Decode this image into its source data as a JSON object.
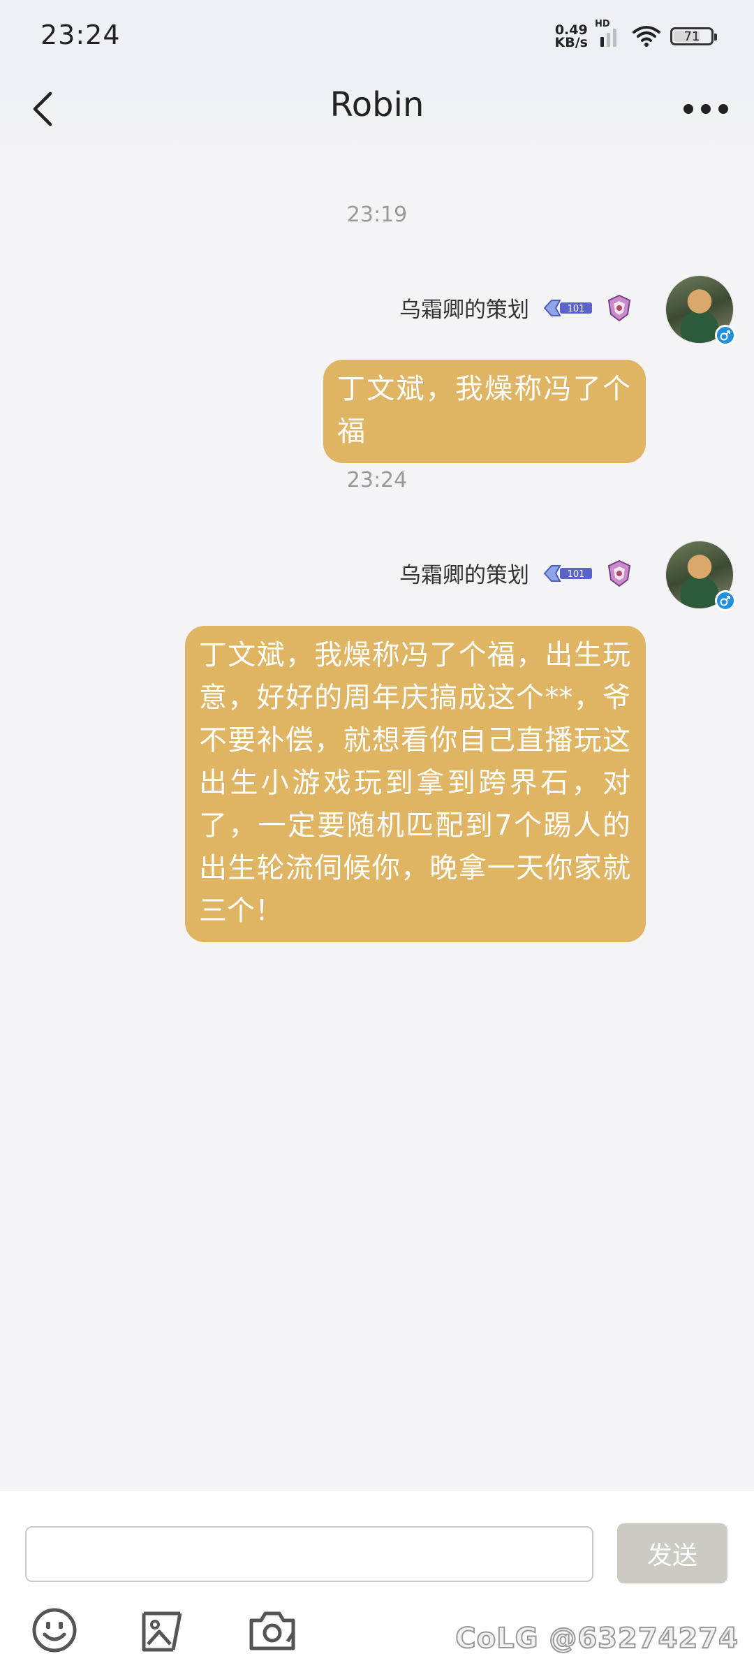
{
  "status_bar": {
    "time": "23:24",
    "net_speed_value": "0.49",
    "net_speed_unit": "KB/s",
    "hd_label": "HD",
    "battery": "71",
    "battery_level": 0.71
  },
  "header": {
    "title": "Robin"
  },
  "messages": [
    {
      "timestamp": "23:19",
      "sender": "乌霜卿的策划",
      "text": "丁文斌，我燥称冯了个福"
    },
    {
      "timestamp": "23:24",
      "sender": "乌霜卿的策划",
      "text": "丁文斌，我燥称冯了个福，出生玩意，好好的周年庆搞成这个**，爷不要补偿，就想看你自己直播玩这出生小游戏玩到拿到跨界石，对了，一定要随机匹配到7个踢人的出生轮流伺候你，晚拿一天你家就三个！"
    }
  ],
  "badges": {
    "rank_text": "101"
  },
  "input": {
    "value": "",
    "placeholder": ""
  },
  "send_label": "发送",
  "toolbar": [
    "emoji-icon",
    "image-icon",
    "camera-icon"
  ],
  "watermark": "CoLG @63274274",
  "colors": {
    "bubble": "#dfb563",
    "page_bg": "#f4f4f6",
    "send_button": "#cccac3",
    "gender_badge": "#1f8fdf"
  }
}
